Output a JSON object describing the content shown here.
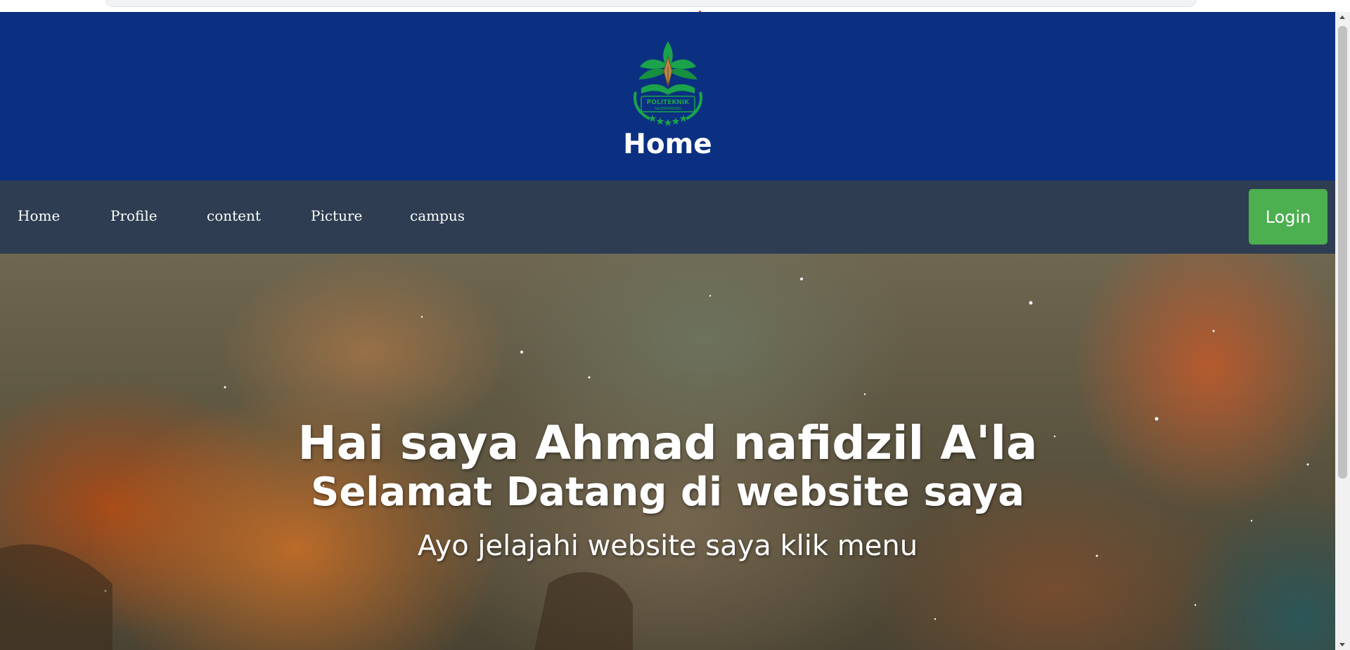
{
  "header": {
    "logo": {
      "text": "POLITEKNIK",
      "subtext": "SALEKAMBANG"
    },
    "title": "Home"
  },
  "nav": {
    "items": [
      {
        "label": "Home"
      },
      {
        "label": "Profile"
      },
      {
        "label": "content"
      },
      {
        "label": "Picture"
      },
      {
        "label": "campus"
      }
    ],
    "login_label": "Login"
  },
  "hero": {
    "title": "Hai saya Ahmad nafidzil A'la",
    "subtitle": "Selamat Datang di website saya",
    "tagline": "Ayo jelajahi website saya klik menu"
  },
  "colors": {
    "header_bg": "#0b3081",
    "nav_bg": "#2e3d51",
    "login_bg": "#4caf50",
    "logo_green": "#1aa34a"
  }
}
